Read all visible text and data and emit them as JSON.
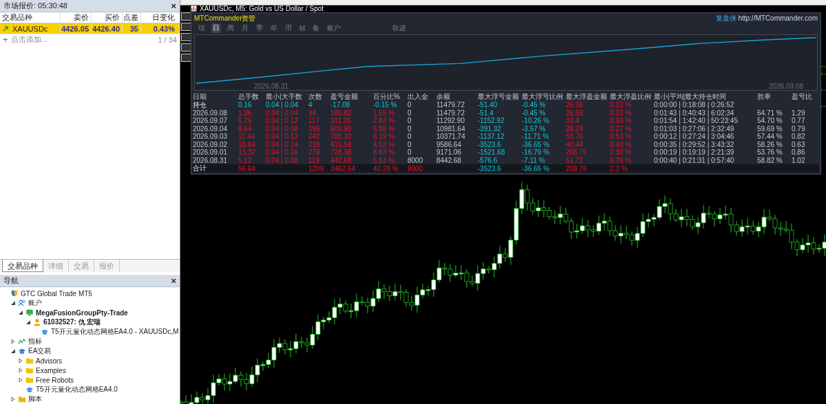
{
  "market_watch": {
    "title": "市场报价: 05:30:48",
    "close": "×",
    "add_icon": "+",
    "columns": [
      "交易品种",
      "卖价",
      "买价",
      "点差",
      "日变化"
    ],
    "rows": [
      {
        "symbol": "XAUUSDc",
        "bid": "4426.05",
        "ask": "4426.40",
        "spread": "35",
        "change": "0.43%",
        "selected": true
      }
    ],
    "add_hint": "点击添加...",
    "count": "1 / 34"
  },
  "tabs": [
    {
      "label": "交易品种",
      "selected": true
    },
    {
      "label": "详细",
      "selected": false
    },
    {
      "label": "交易",
      "selected": false
    },
    {
      "label": "报价",
      "selected": false
    }
  ],
  "navigator": {
    "title": "导航",
    "close": "×",
    "tree": [
      {
        "label": "GTC Global Trade MT5",
        "kind": "server",
        "children": [
          {
            "label": "账户",
            "kind": "accounts",
            "expanded": true,
            "children": [
              {
                "label": "MegaFusionGroupPty-Trade",
                "kind": "account-server",
                "expanded": true,
                "children": [
                  {
                    "label": "61032527: 仇 宏瑞",
                    "kind": "user",
                    "expanded": true,
                    "children": [
                      {
                        "label": "T5开元量化动态网格EA4.0 - XAUUSDc,M",
                        "kind": "ea"
                      }
                    ]
                  }
                ]
              }
            ]
          },
          {
            "label": "指标",
            "kind": "indicators",
            "expanded": false
          },
          {
            "label": "EA交易",
            "kind": "experts",
            "expanded": true,
            "children": [
              {
                "label": "Advisors",
                "kind": "folder",
                "expanded": false
              },
              {
                "label": "Examples",
                "kind": "folder",
                "expanded": false
              },
              {
                "label": "Free Robots",
                "kind": "folder",
                "expanded": false
              },
              {
                "label": "T5开元量化动态网格EA4.0",
                "kind": "ea"
              }
            ]
          },
          {
            "label": "脚本",
            "kind": "script",
            "expanded": false
          }
        ]
      }
    ]
  },
  "chart_window": {
    "title": "XAUUSDc, M5:  Gold vs US Dollar / Spot"
  },
  "commander": {
    "brand": "MTCommander资管",
    "site_name": "复盘侠",
    "site_url": "http://MTCommander.com",
    "periods": [
      {
        "label": "综",
        "selected": false
      },
      {
        "label": "日",
        "selected": true
      },
      {
        "label": "周",
        "selected": false
      },
      {
        "label": "月",
        "selected": false
      },
      {
        "label": "季",
        "selected": false
      },
      {
        "label": "年",
        "selected": false
      },
      {
        "label": "币",
        "selected": false
      },
      {
        "label": "M",
        "selected": false
      },
      {
        "label": "备",
        "selected": false
      },
      {
        "label": "账户",
        "selected": false
      }
    ],
    "trace_label": "轨迹",
    "equity_dates": [
      "2026.08.31",
      "2026.09.08"
    ],
    "columns": [
      "日期",
      "总手数",
      "最小|大手数",
      "次数",
      "盈亏金额",
      "百分比%",
      "出入金",
      "余额",
      "最大浮亏金额",
      "最大浮亏比例",
      "最大浮盈金额",
      "最大浮盈比例",
      "最小|平均|最大持仓时间",
      "胜率",
      "盈亏比"
    ],
    "rows": [
      {
        "kind": "open",
        "cells": [
          "持仓",
          "0.16",
          "0.04 | 0.04",
          "4",
          "-17.08",
          "-0.15 %",
          "0",
          "11479.72",
          "-51.40",
          "-0.45 %",
          "26.56",
          "0.23 %",
          "0:00:00 | 0:18:08 | 0:26:52",
          null,
          null
        ]
      },
      {
        "kind": "day",
        "cells": [
          "2026.09.08",
          "1.36",
          "0.04 | 0.04",
          "34",
          "186.82",
          "1.65 %",
          "0",
          "11479.72",
          "-51.4",
          "-0.45 %",
          "26.56",
          "0.23 %",
          "0:01:43 | 0:40:43 | 6:02:34",
          "64.71 %",
          "1.29"
        ]
      },
      {
        "kind": "day",
        "cells": [
          "2026.09.07",
          "5.76",
          "0.04 | 0.12",
          "117",
          "311.26",
          "2.83 %",
          "0",
          "11292.90",
          "-1152.92",
          "-10.26 %",
          "33.4",
          "0.30 %",
          "0:01:54 | 1:42:40 | 50:23:45",
          "54.70 %",
          "0.77"
        ]
      },
      {
        "kind": "day",
        "cells": [
          "2026.09.04",
          "8.64",
          "0.04 | 0.08",
          "196",
          "609.90",
          "5.88 %",
          "0",
          "10981.64",
          "-391.32",
          "-3.57 %",
          "28.24",
          "0.27 %",
          "0:01:03 | 0:27:06 | 2:32:49",
          "59.69 %",
          "0.79"
        ]
      },
      {
        "kind": "day",
        "cells": [
          "2026.09.03",
          "11.44",
          "0.04 | 0.12",
          "242",
          "785.10",
          "8.19 %",
          "0",
          "10371.74",
          "-1137.12",
          "-11.71 %",
          "53.76",
          "0.53 %",
          "0:00:12 | 0:27:24 | 3:04:46",
          "57.44 %",
          "0.82"
        ]
      },
      {
        "kind": "day",
        "cells": [
          "2026.09.02",
          "10.84",
          "0.04 | 0.24",
          "218",
          "415.58",
          "4.53 %",
          "0",
          "9586.64",
          "-3523.6",
          "-36.65 %",
          "40.44",
          "0.43 %",
          "0:00:35 | 0:29:52 | 3:43:32",
          "58.26 %",
          "0.63"
        ]
      },
      {
        "kind": "day",
        "cells": [
          "2026.09.01",
          "13.32",
          "0.04 | 0.16",
          "279",
          "728.38",
          "8.63 %",
          "0",
          "9171.06",
          "-1521.68",
          "-16.79 %",
          "208.76",
          "2.30 %",
          "0:00:19 | 0:19:19 | 2:21:39",
          "53.76 %",
          "0.86"
        ]
      },
      {
        "kind": "day",
        "cells": [
          "2026.08.31",
          "5.12",
          "0.04 | 0.08",
          "119",
          "442.68",
          "5.53 %",
          "8000",
          "8442.68",
          "-576.6",
          "-7.11 %",
          "61.72",
          "0.76 %",
          "0:00:40 | 0:21:31 | 0:57:40",
          "58.82 %",
          "1.02"
        ]
      },
      {
        "kind": "total",
        "cells": [
          "合计",
          "56.64",
          null,
          "1209",
          "3462.64",
          "43.28 %",
          "8000",
          null,
          "-3523.6",
          "-36.65 %",
          "208.76",
          "2.3 %",
          null,
          null,
          null
        ]
      }
    ]
  }
}
